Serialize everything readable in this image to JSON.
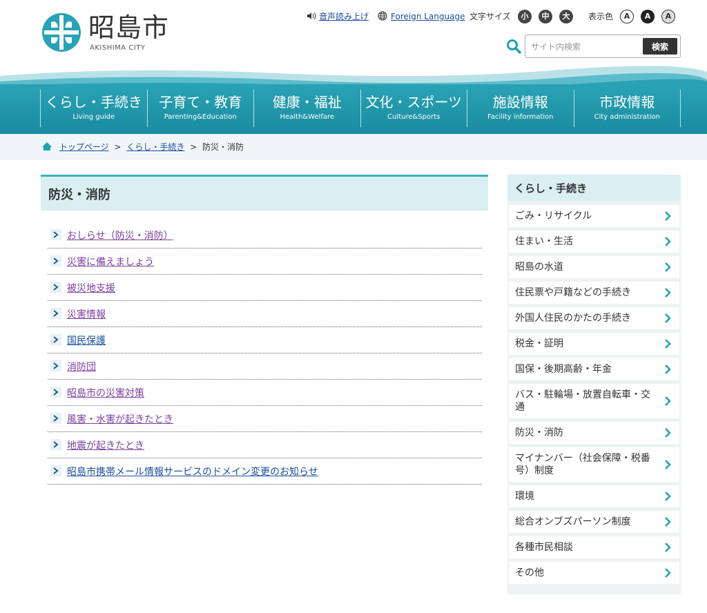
{
  "header": {
    "logo_name": "昭島市",
    "logo_sub": "AKISHIMA CITY",
    "util": {
      "speech_label": "音声読み上げ",
      "foreign_label": "Foreign Language",
      "font_size_label": "文字サイズ",
      "font_sizes": [
        "小",
        "中",
        "大"
      ],
      "color_label": "表示色",
      "colors": [
        "A",
        "A",
        "A"
      ]
    },
    "search": {
      "placeholder": "サイト内検索",
      "button_label": "検索"
    }
  },
  "nav": [
    {
      "jp": "くらし・手続き",
      "en": "Living guide"
    },
    {
      "jp": "子育て・教育",
      "en": "Parenting&Education"
    },
    {
      "jp": "健康・福祉",
      "en": "Health&Welfare"
    },
    {
      "jp": "文化・スポーツ",
      "en": "Culture&Sports"
    },
    {
      "jp": "施設情報",
      "en": "Facility information"
    },
    {
      "jp": "市政情報",
      "en": "City administration"
    }
  ],
  "breadcrumb": {
    "items": [
      "トップページ",
      "くらし・手続き",
      "防災・消防"
    ],
    "separator": ">"
  },
  "main": {
    "title": "防災・消防",
    "links": [
      "おしらせ（防災・消防）",
      "災害に備えましょう",
      "被災地支援",
      "災害情報",
      "国民保護",
      "消防団",
      "昭島市の災害対策",
      "風害・水害が起きたとき",
      "地震が起きたとき",
      "昭島市携帯メール情報サービスのドメイン変更のお知らせ"
    ]
  },
  "sidebar": {
    "title": "くらし・手続き",
    "items": [
      "ごみ・リサイクル",
      "住まい・生活",
      "昭島の水道",
      "住民票や戸籍などの手続き",
      "外国人住民のかたの手続き",
      "税金・証明",
      "国保・後期高齢・年金",
      "バス・駐輪場・放置自転車・交通",
      "防災・消防",
      "マイナンバー（社会保障・税番号）制度",
      "環境",
      "総合オンブズパーソン制度",
      "各種市民相談",
      "その他"
    ]
  },
  "colors": {
    "accent": "#1fa0b3",
    "nav_bg": "#2aa2b5",
    "heading_bg": "#d9eff2",
    "link_blue": "#1a4f9c",
    "link_visited": "#7b3fa0"
  }
}
